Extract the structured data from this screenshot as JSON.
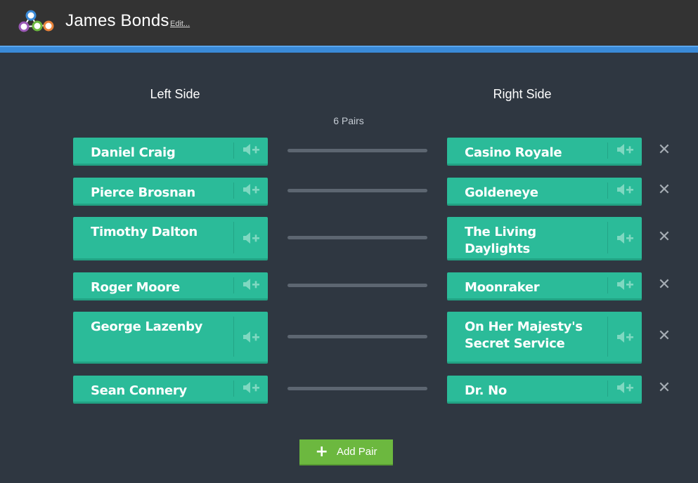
{
  "header": {
    "title": "James Bonds",
    "edit_label": "Edit...",
    "logo_icon": "connected-circles-logo"
  },
  "columns": {
    "left_heading": "Left Side",
    "right_heading": "Right Side",
    "pairs_count": "6 Pairs"
  },
  "pairs": [
    {
      "left": "Daniel Craig",
      "right": "Casino Royale"
    },
    {
      "left": "Pierce Brosnan",
      "right": "Goldeneye"
    },
    {
      "left": "Timothy Dalton",
      "right": "The Living Daylights"
    },
    {
      "left": "Roger Moore",
      "right": "Moonraker"
    },
    {
      "left": "George Lazenby",
      "right": "On Her Majesty's Secret Service"
    },
    {
      "left": "Sean Connery",
      "right": "Dr. No"
    }
  ],
  "icons": {
    "audio": "add-audio-icon",
    "remove": "close-icon",
    "remove_glyph": "✕"
  },
  "add_pair": {
    "label": "Add Pair",
    "icon_glyph": "+"
  },
  "colors": {
    "background": "#2f3741",
    "header": "#333333",
    "accent": "#3a8ad8",
    "card": "#2bbb99",
    "add_button": "#6cb83f"
  }
}
